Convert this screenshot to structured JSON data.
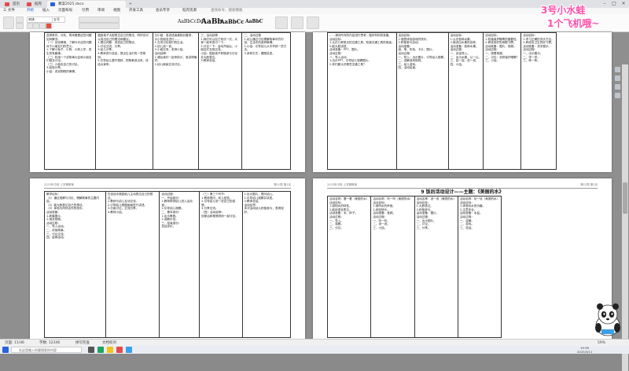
{
  "tabs": [
    {
      "label": "首页",
      "color": "#e24b4b"
    },
    {
      "label": "稻壳",
      "color": "#e24b4b"
    },
    {
      "label": "教案2025.docx",
      "color": "#2b62d9"
    }
  ],
  "menu": [
    "三 文件",
    "开始",
    "插入",
    "页面布局",
    "引用",
    "审阅",
    "视图",
    "开发工具",
    "会员专享",
    "稻壳资源",
    "查找命令、搜索模板"
  ],
  "menu_active_index": 1,
  "ribbon": {
    "style1": "AaBbCcDd",
    "style2": "AaBb",
    "style3": "AaBbCc",
    "style4": "AaBbC",
    "font_name": "宋体",
    "font_size": "五号"
  },
  "overlay": {
    "line1": "3号小水蛙",
    "line2": "1个飞机哦~"
  },
  "pages": [
    {
      "header_left": "",
      "header_right": "",
      "cols": [
        "选择条件、分析、再来看看这些问题如何解决。\n（一）创设情境，了解今天这些问题对于小朋友们的意义。\n1.了解小兔子、小狗、小熊上学，发生的有趣事。\n（二）利用一个讲故事大会和小朋友们相互讨论。\n（三）小朋友自己的讨论。\n3.经验分享。\n小结：说说刚刚的事情。",
        "鼓励孩子大胆表达自己的想法，同时也可以说出自己的看法和建议。\n1.提出问题：说说自己的想法。\n2.讨论交流，分享。\n3.幼儿分享。\n4.教师进行总结，提出生活中的一些规则。\n5.引导幼儿遵守规则，把故事讲出来，讲给大家听。",
        "分小组：各讲述者都相对要求，大小的朋友进行……\n1.交流讨论我们的生活。\n2.幼儿说一说。\n3.小组交流，老师小结。\n活动延伸：\n1.课后我们一起来探讨，谁讲得最好。\n2.幼儿继续交流讨论。",
        "三、活动延伸\n1.我们可以自己来试一试，大家一起来探讨一下。\n2.讨论一下：活动开始后，小朋友们互相交流。\n小结：鼓励孩子积极参与讨论并大胆表达。\n3.教师总结。",
        "二、活动过程\n1.幼儿通过讨论理解故事中的内容，生活中的各种事情。\n2.小结：引导幼儿从中学到一些方法。\n3.多种方式：看图讲述。"
      ]
    },
    {
      "header_left": "",
      "header_right": "",
      "cols": [
        "……请对所写的内容进行思考，做好材料的准备。\n活动目标：\n1.认识几种常见的交通工具，知道交通工具的用途。\n2.能大胆讲述。\n活动准备：PPT、图片。\n活动过程：\n一、导入活动\n1.出示PPT，引导幼儿观察图片。\n2.你们都认识哪些交通工具？",
        "活动目标：\n1.感受体验游戏的快乐。\n2.积极参与活动。\n活动准备：\n纸、笔、彩色、卡片、图片。\n活动过程：\n一、导入：出示图片，引导幼儿观察。\n二、讲解游戏规则。\n三、幼儿游戏。\n四、活动结束。",
        "活动目标：\n1.认识各种水果。\n2.能说出水果的名称。\n活动准备：各种水果。\n活动过程：\n一、谈话导入。\n二、出示水果，认一认。\n三、尝一尝，说一说。\n四、小结。",
        "活动目标：\n1.知道保护眼睛的重要性。\n2.养成良好的用眼习惯。\n活动准备：图片、视频。\n活动过程：\n一、观看视频。\n二、讨论：怎样保护眼睛？\n三、小结。",
        "活动目标：\n1.学习正确的洗手方法。\n2.养成讲卫生的好习惯。\n活动准备：洗手图示。\n活动过程：\n一、出示图示。\n二、学一学。\n三、练一练。"
      ]
    },
    {
      "header_left": "2025年中班·上学期教案",
      "header_right": "第12周 第1页",
      "cols": [
        "教学目标：\n（1）通过观察与讨论，理解故事的主要内容。\n（2）能大胆表达自己的想法。\n（3）体验与同伴合作的快乐。\n活动准备：\n1.故事图片。\n2.相关视频。\n活动过程：\n一、导入活动。\n二、欣赏故事。\n三、讨论交流。\n四、延伸活动。",
        "在谈话中鼓励幼儿主动表达自己的想法。\n1.教师与幼儿互动交流。\n2.引导幼儿根据画面进行讲述。\n3.分组讨论，交流分享。\n4.教师小结。",
        "活动过程：\n一、开始部分：\n1.教师带领幼儿进入活动室。\n2.引导幼儿观察。\n二、基本部分：\n1.出示教具。\n2.讲解示范。\n三、结束部分：\n总结评价。",
        "（三）第三个环节：\n1.教师提问，幼儿回答。\n2.引导幼儿说一说自己的感受。\n3.分享交流。\n（四）活动延伸：\n回家后和爸爸妈妈一起讨论。",
        "1.出示图片，提问幼儿。\n2.引导幼儿观察并讲述。\n3.教师总结。\n活动反思：\n本次活动幼儿积极参与，表现较好。"
      ]
    },
    {
      "header_left": "2025年中班·上学期教案",
      "header_right": "第12周 第2页",
      "title": "9 饭后活动设计——主题：《美丽的水》",
      "cols": [
        "活动名称：看一看（美丽的水）\n活动目标：\n1.感知水的特性。\n2.能用语言表达。\n活动准备：水、杯子。\n活动过程：\n一、导入。\n二、观察。\n三、讨论。",
        "活动名称：听一听（美丽的水）\n活动目标：\n1.倾听水的声音。\n2.体验快乐。\n活动准备：音频。\n活动过程：\n一、听一听。\n二、说一说。\n三、小结。",
        "活动名称：说一说（美丽的水）\n活动目标：\n1.大胆表达。\n2.积极参与。\n活动准备：图片。\n活动过程：\n一、出示图片。\n二、讨论。\n三、分享。",
        "活动名称：玩一玩（美丽的水）\n活动目标：\n1.体验玩水的乐趣。\n2.注意安全。\n活动准备：水盆。\n活动过程：\n一、讲解。\n二、游戏。\n三、总结。"
      ]
    }
  ],
  "status": {
    "page": "页面: 11/46",
    "words": "字数: 12346",
    "spell": "拼写检查",
    "doc_check": "文档校对",
    "zoom": "59%"
  },
  "taskbar": {
    "search_placeholder": "在这里输入你要搜索的内容",
    "time": "19:36",
    "date": "2025/3/11"
  }
}
